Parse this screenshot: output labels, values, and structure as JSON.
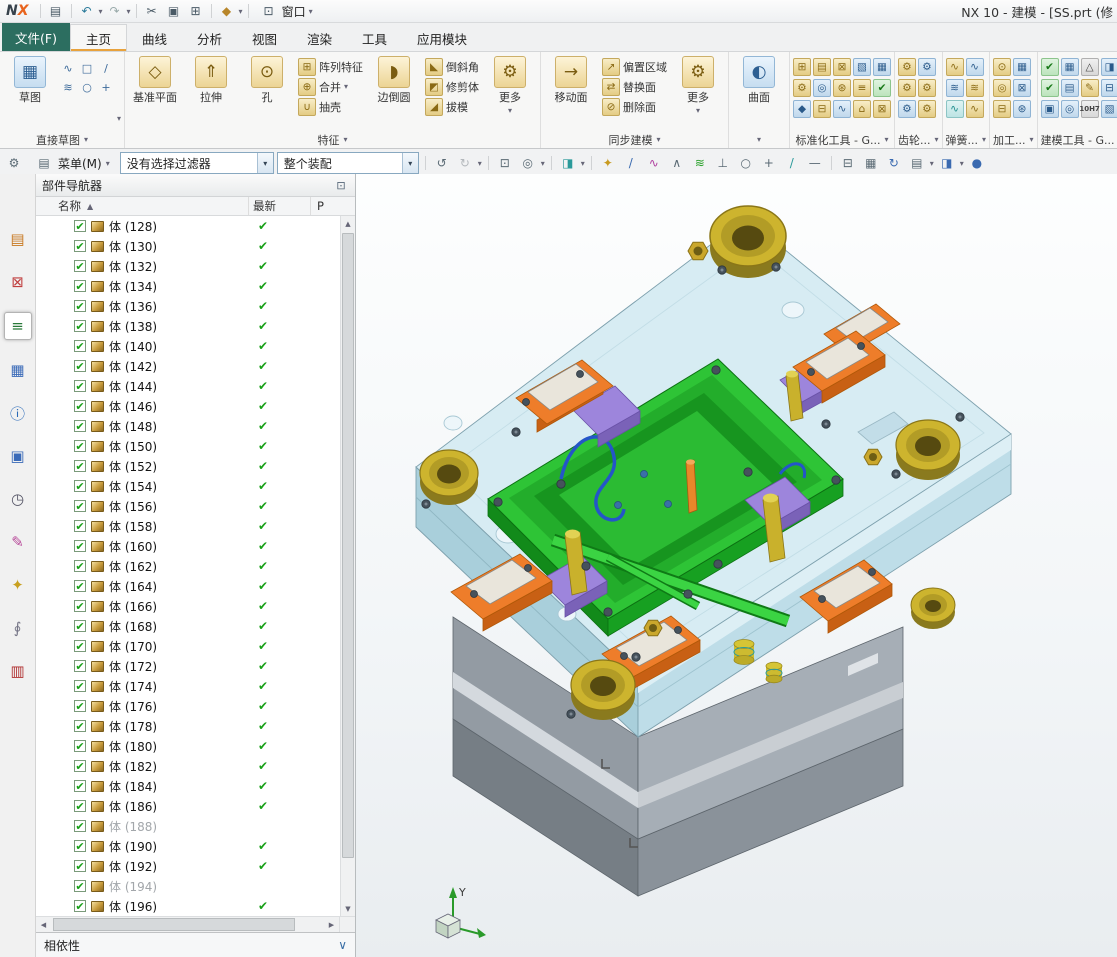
{
  "titlebar": {
    "logo_n": "N",
    "logo_x": "X",
    "window_menu": "窗口",
    "title": "NX 10 - 建模 - [SS.prt  (修"
  },
  "tabs": [
    {
      "label": "文件(F)",
      "file": true
    },
    {
      "label": "主页",
      "active": true
    },
    {
      "label": "曲线"
    },
    {
      "label": "分析"
    },
    {
      "label": "视图"
    },
    {
      "label": "渲染"
    },
    {
      "label": "工具"
    },
    {
      "label": "应用模块"
    }
  ],
  "ribbon": {
    "sketch": "草图",
    "datum_plane": "基准平面",
    "extrude": "拉伸",
    "hole": "孔",
    "pattern": "阵列特征",
    "unite": "合并",
    "shell": "抽壳",
    "edge_blend": "边倒圆",
    "chamfer": "倒斜角",
    "trim_body": "修剪体",
    "draft": "拔模",
    "more": "更多",
    "move_face": "移动面",
    "offset_region": "偏置区域",
    "replace_face": "替换面",
    "delete_face": "删除面",
    "surface": "曲面",
    "tol": "10H7",
    "labels": {
      "dire ct_sketch": "",
      "direct_sketch": "直接草图",
      "feature": "特征",
      "sync": "同步建模",
      "std": "标准化工具 - G...",
      "gear": "齿轮...",
      "spring": "弹簧...",
      "mach": "加工...",
      "model": "建模工具 - G..."
    }
  },
  "selection_bar": {
    "menu": "菜单(M)",
    "filter": "没有选择过滤器",
    "scope": "整个装配"
  },
  "navigator": {
    "title": "部件导航器",
    "columns": {
      "name": "名称",
      "latest": "最新",
      "p": "P"
    },
    "footer": "相依性",
    "rows": [
      {
        "label": "体 (128)"
      },
      {
        "label": "体 (130)"
      },
      {
        "label": "体 (132)"
      },
      {
        "label": "体 (134)"
      },
      {
        "label": "体 (136)"
      },
      {
        "label": "体 (138)"
      },
      {
        "label": "体 (140)"
      },
      {
        "label": "体 (142)"
      },
      {
        "label": "体 (144)"
      },
      {
        "label": "体 (146)"
      },
      {
        "label": "体 (148)"
      },
      {
        "label": "体 (150)"
      },
      {
        "label": "体 (152)"
      },
      {
        "label": "体 (154)"
      },
      {
        "label": "体 (156)"
      },
      {
        "label": "体 (158)"
      },
      {
        "label": "体 (160)"
      },
      {
        "label": "体 (162)"
      },
      {
        "label": "体 (164)"
      },
      {
        "label": "体 (166)"
      },
      {
        "label": "体 (168)"
      },
      {
        "label": "体 (170)"
      },
      {
        "label": "体 (172)"
      },
      {
        "label": "体 (174)"
      },
      {
        "label": "体 (176)"
      },
      {
        "label": "体 (178)"
      },
      {
        "label": "体 (180)"
      },
      {
        "label": "体 (182)"
      },
      {
        "label": "体 (184)"
      },
      {
        "label": "体 (186)"
      },
      {
        "label": "体 (188)",
        "dim": true
      },
      {
        "label": "体 (190)"
      },
      {
        "label": "体 (192)"
      },
      {
        "label": "体 (194)",
        "dim": true
      },
      {
        "label": "体 (196)"
      }
    ]
  },
  "viewport": {
    "triad_label": "Y"
  },
  "palette": {
    "plate_cyan": "#d7ecf3",
    "plate_green": "#2ec436",
    "clamp_orange": "#ee7d2a",
    "bushing_brass": "#cdb42e",
    "slide_purple": "#9d85dc",
    "base_gray": "#8e969e",
    "check_green": "#18a018",
    "file_tab_bg": "#2c6e60",
    "active_tab_underline": "#e8a23c"
  },
  "icons": {
    "dropdown": "▾",
    "save": "▤",
    "undo": "↶",
    "redo": "↷",
    "cut": "✂",
    "copy": "▣",
    "paste": "⊞",
    "tools": "◆",
    "window": "⊡",
    "gear": "⚙",
    "check": "✔",
    "sort_asc": "▲",
    "undock": "⊡",
    "scroll_up": "▲",
    "scroll_down": "▼",
    "scroll_left": "◀",
    "scroll_right": "▶",
    "chevron_down": "∨",
    "sketch": "▦",
    "spline": "∿",
    "rect": "□",
    "slash": "/",
    "spline_g": "≋",
    "circle": "○",
    "plus": "+",
    "datum": "◇",
    "extrude": "⇑",
    "hole": "⊙",
    "pattern": "⊞",
    "unite": "⊕",
    "shell": "∪",
    "blend": "◗",
    "chamfer": "◣",
    "trim": "◩",
    "draft": "◢",
    "move_face": "→",
    "offset": "↗",
    "replace": "⇄",
    "delete_face": "⊘",
    "surface": "◐",
    "grid": "▦",
    "table": "▤",
    "target": "◎",
    "wave": "∿",
    "box": "⊠",
    "home": "⌂",
    "burst": "⊛",
    "shade": "▧",
    "diamond": "◆",
    "menu_lines": "≡",
    "tri": "△",
    "screen": "⊟",
    "star": "✦",
    "info": "ⓘ",
    "clock": "◷",
    "pencil": "✎",
    "loop": "∮",
    "book": "▥",
    "corner": "∧",
    "perp": "⊥",
    "dash": "—",
    "rotate_l": "↺",
    "rotate_r": "↻",
    "cube": "◨",
    "sphere": "●"
  }
}
